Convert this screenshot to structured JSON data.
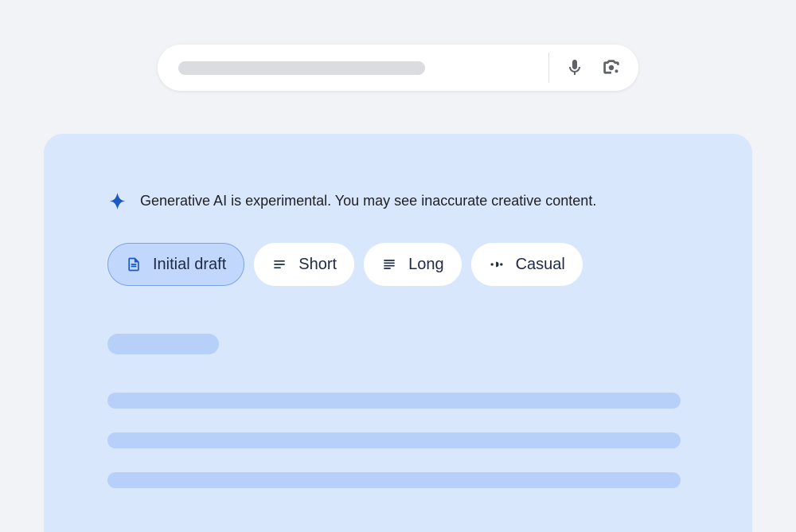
{
  "notice": {
    "text": "Generative AI is experimental. You may see inaccurate creative content."
  },
  "chips": {
    "initialDraft": "Initial draft",
    "short": "Short",
    "long": "Long",
    "casual": "Casual"
  }
}
